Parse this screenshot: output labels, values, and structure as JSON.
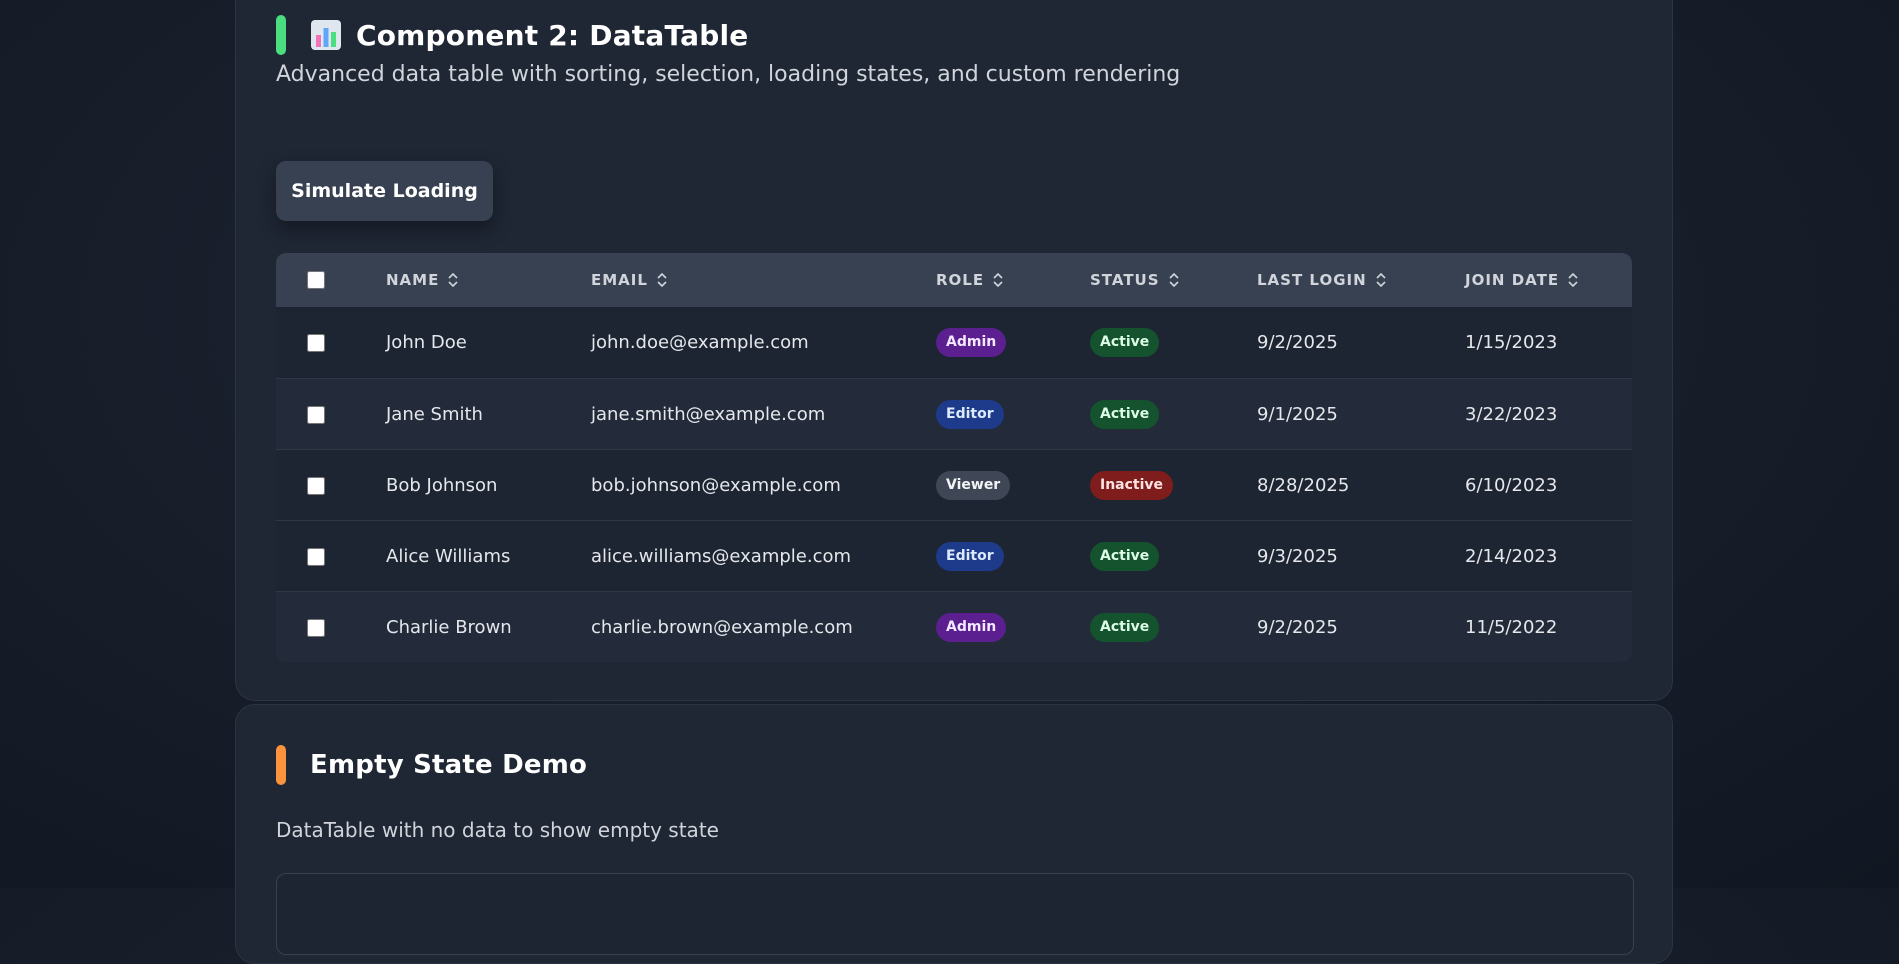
{
  "datatable_section": {
    "title": "Component 2: DataTable",
    "icon": "bar-chart-icon",
    "accent_color": "#4ade80",
    "description": "Advanced data table with sorting, selection, loading states, and custom rendering",
    "simulate_button_label": "Simulate Loading",
    "columns": [
      "NAME",
      "EMAIL",
      "ROLE",
      "STATUS",
      "LAST LOGIN",
      "JOIN DATE"
    ],
    "rows": [
      {
        "name": "John Doe",
        "email": "john.doe@example.com",
        "role": "Admin",
        "status": "Active",
        "last_login": "9/2/2025",
        "join_date": "1/15/2023"
      },
      {
        "name": "Jane Smith",
        "email": "jane.smith@example.com",
        "role": "Editor",
        "status": "Active",
        "last_login": "9/1/2025",
        "join_date": "3/22/2023"
      },
      {
        "name": "Bob Johnson",
        "email": "bob.johnson@example.com",
        "role": "Viewer",
        "status": "Inactive",
        "last_login": "8/28/2025",
        "join_date": "6/10/2023"
      },
      {
        "name": "Alice Williams",
        "email": "alice.williams@example.com",
        "role": "Editor",
        "status": "Active",
        "last_login": "9/3/2025",
        "join_date": "2/14/2023"
      },
      {
        "name": "Charlie Brown",
        "email": "charlie.brown@example.com",
        "role": "Admin",
        "status": "Active",
        "last_login": "9/2/2025",
        "join_date": "11/5/2022"
      }
    ],
    "role_colors": {
      "Admin": "#5b1f8f",
      "Editor": "#1e3a8a",
      "Viewer": "#3f4756"
    },
    "status_colors": {
      "Active": "#14532d",
      "Inactive": "#7f1d1d"
    }
  },
  "empty_section": {
    "title": "Empty State Demo",
    "accent_color": "#fb923c",
    "description": "DataTable with no data to show empty state"
  }
}
